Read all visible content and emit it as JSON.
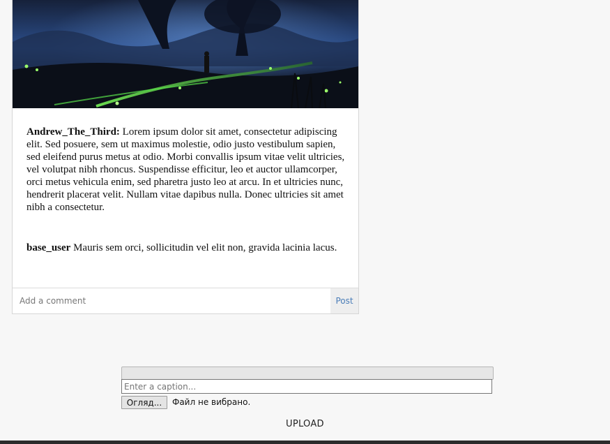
{
  "post": {
    "comments": [
      {
        "author": "Andrew_The_Third:",
        "text": "Lorem ipsum dolor sit amet, consectetur adipiscing elit. Sed posuere, sem ut maximus molestie, odio justo vestibulum sapien, sed eleifend purus metus at odio. Morbi convallis ipsum vitae velit ultricies, vel volutpat nibh rhoncus. Suspendisse efficitur, leo et auctor ullamcorper, orci metus vehicula enim, sed pharetra justo leo at arcu. In et ultricies nunc, hendrerit placerat velit. Nullam vitae dapibus nulla. Donec ultricies sit amet nibh a consectetur."
      },
      {
        "author": "base_user",
        "text": "Mauris sem orci, sollicitudin vel elit non, gravida lacinia lacus."
      }
    ],
    "comment_placeholder": "Add a comment",
    "post_button": "Post"
  },
  "upload": {
    "progress_percent": 0,
    "caption_placeholder": "Enter a caption...",
    "file_button": "Огляд...",
    "file_status": "Файл не вибрано.",
    "upload_button": "UPLOAD"
  },
  "colors": {
    "accent": "#4a7db8",
    "page_background": "#f7f7f7"
  }
}
